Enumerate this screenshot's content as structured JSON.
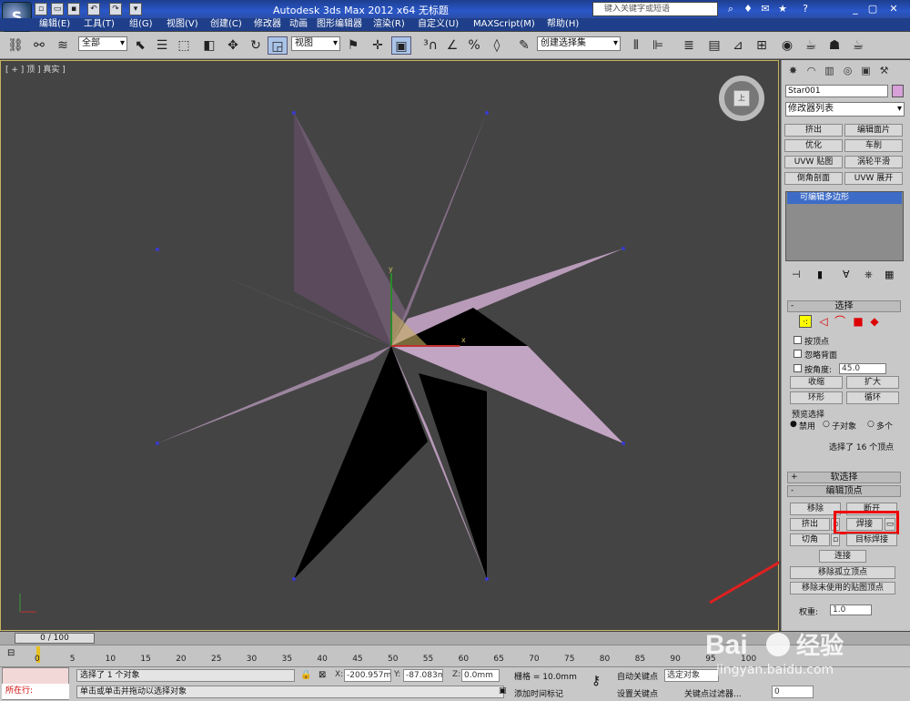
{
  "title": "Autodesk 3ds Max  2012 x64     无标题",
  "search_placeholder": "键入关键字或短语",
  "menu": [
    "编辑(E)",
    "工具(T)",
    "组(G)",
    "视图(V)",
    "创建(C)",
    "修改器",
    "动画",
    "图形编辑器",
    "渲染(R)",
    "自定义(U)",
    "MAXScript(M)",
    "帮助(H)"
  ],
  "toolbar": {
    "selection_filter": "全部",
    "ref_coord": "视图",
    "named_selection": "创建选择集"
  },
  "viewport": {
    "label": "[ + ] 顶 ] 真实 ]",
    "cube_face": "上",
    "axis_x": "x",
    "axis_y": "y"
  },
  "panel": {
    "object_name": "Star001",
    "object_color": "#d7a0d9",
    "modifier_list": "修改器列表",
    "modifier_buttons": [
      "挤出",
      "编辑面片",
      "优化",
      "车削",
      "UVW 贴图",
      "涡轮平滑",
      "倒角剖面",
      "UVW 展开"
    ],
    "stack_item": "可编辑多边形",
    "selection": {
      "title": "选择",
      "by_vertex": "按顶点",
      "ignore_backfacing": "忽略背面",
      "by_angle": "按角度:",
      "angle_value": "45.0",
      "shrink": "收缩",
      "grow": "扩大",
      "ring": "环形",
      "loop": "循环",
      "preview_title": "预览选择",
      "preview_off": "禁用",
      "preview_subobj": "子对象",
      "preview_multi": "多个",
      "selected_info": "选择了 16 个顶点"
    },
    "soft_selection": "软选择",
    "edit_vertices": {
      "title": "编辑顶点",
      "remove": "移除",
      "break": "断开",
      "extrude": "挤出",
      "weld": "焊接",
      "chamfer": "切角",
      "target_weld": "目标焊接",
      "connect": "连接",
      "remove_isolated": "移除孤立顶点",
      "remove_unused": "移除未使用的贴图顶点",
      "weight_label": "权重:",
      "weight_value": "1.0"
    }
  },
  "timeline": {
    "frame": "0 / 100",
    "ticks": [
      "0",
      "5",
      "10",
      "15",
      "20",
      "25",
      "30",
      "35",
      "40",
      "45",
      "50",
      "55",
      "60",
      "65",
      "70",
      "75",
      "80",
      "85",
      "90",
      "95",
      "100"
    ]
  },
  "status": {
    "script_label": "所在行:",
    "selected": "选择了 1 个对象",
    "prompt": "单击或单击并拖动以选择对象",
    "x_label": "X:",
    "x_value": "-200.957m",
    "y_label": "Y:",
    "y_value": "-87.083mm",
    "z_label": "Z:",
    "z_value": "0.0mm",
    "grid": "栅格 = 10.0mm",
    "add_time_tag": "添加时间标记",
    "auto_key": "自动关键点",
    "set_key": "设置关键点",
    "selected_obj": "选定对象",
    "key_filters": "关键点过滤器...",
    "frame_field": "0"
  },
  "watermark": {
    "brand": "Bai",
    "brand2": "经验",
    "url": "jingyan.baidu.com"
  }
}
